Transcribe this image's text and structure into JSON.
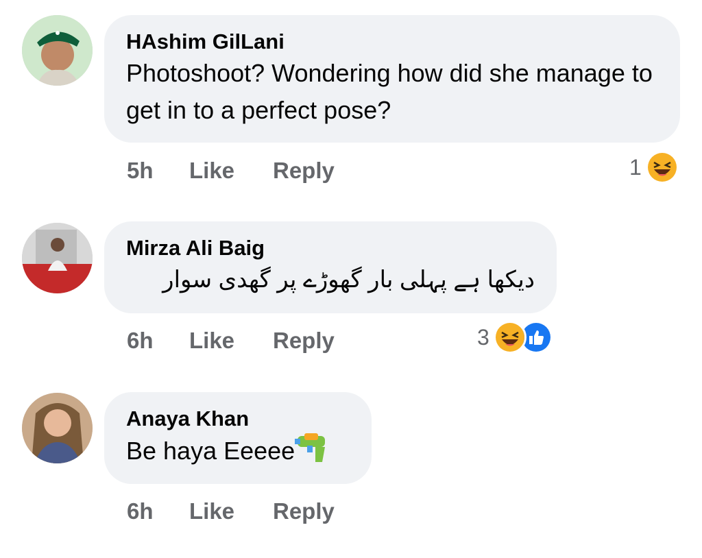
{
  "comments": [
    {
      "author": "HAshim GilLani",
      "text": "Photoshoot? Wondering how did she manage to get in to a perfect pose?",
      "time": "5h",
      "like": "Like",
      "reply": "Reply",
      "reaction_count": "1",
      "reactions": [
        "haha-icon"
      ]
    },
    {
      "author": "Mirza Ali Baig",
      "text": "دیکھا ہے پہلی بار گھوڑے پر گھدی سوار",
      "time": "6h",
      "like": "Like",
      "reply": "Reply",
      "reaction_count": "3",
      "reactions": [
        "haha-icon",
        "like-icon"
      ]
    },
    {
      "author": "Anaya Khan",
      "text": "Be haya Eeeee",
      "text_emoji": "water-pistol-icon",
      "time": "6h",
      "like": "Like",
      "reply": "Reply"
    }
  ],
  "colors": {
    "bubble": "#f0f2f5",
    "meta": "#65676b",
    "like_blue": "#1877f2",
    "haha_yellow": "#f7b125"
  }
}
